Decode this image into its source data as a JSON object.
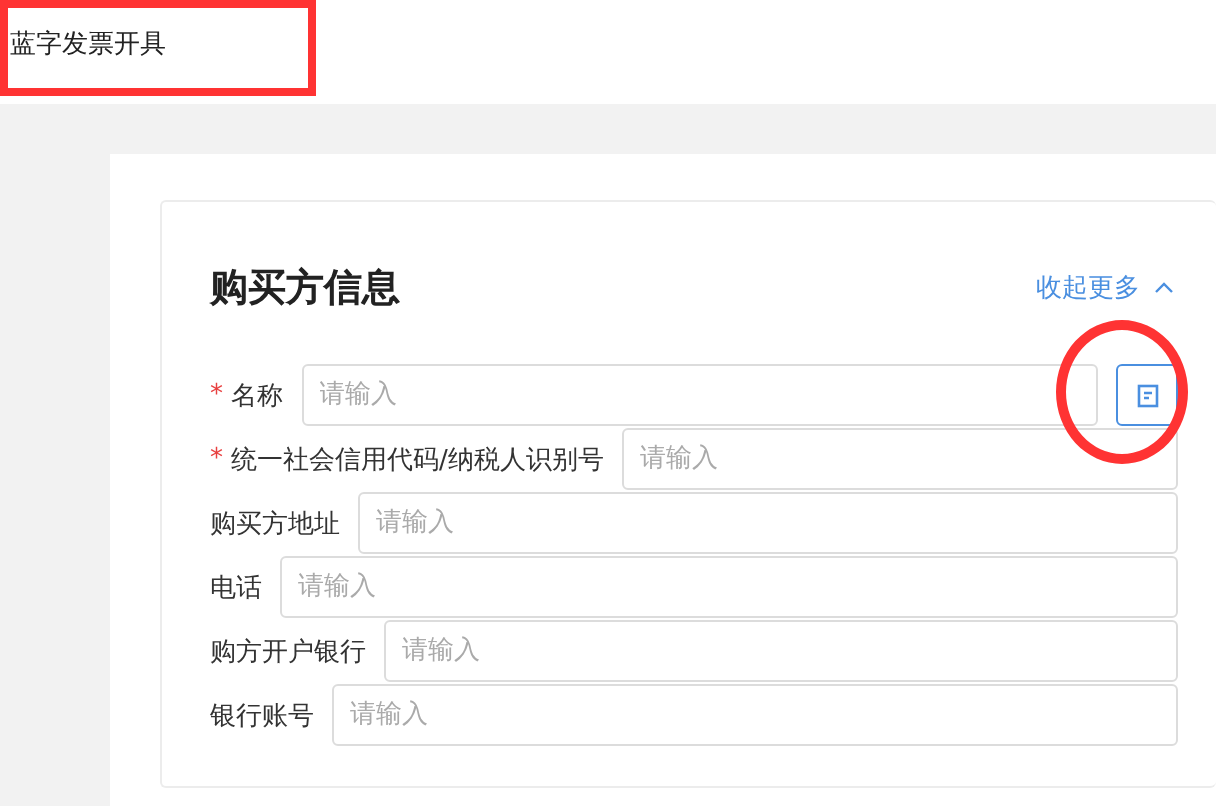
{
  "page": {
    "title": "蓝字发票开具"
  },
  "required_mark": "*",
  "section": {
    "title": "购买方信息",
    "toggle": "收起更多",
    "expanded": true
  },
  "fields": [
    {
      "label": "名称",
      "required": true,
      "placeholder": "请输入",
      "kind": "with-button"
    },
    {
      "label": "统一社会信用代码/纳税人识别号",
      "required": true,
      "placeholder": "请输入",
      "kind": "plain"
    },
    {
      "label": "购买方地址",
      "required": false,
      "placeholder": "请输入",
      "kind": "plain"
    },
    {
      "label": "电话",
      "required": false,
      "placeholder": "请输入",
      "kind": "plain"
    },
    {
      "label": "购方开户银行",
      "required": false,
      "placeholder": "请输入",
      "kind": "plain"
    },
    {
      "label": "银行账号",
      "required": false,
      "placeholder": "请输入",
      "kind": "plain"
    }
  ]
}
